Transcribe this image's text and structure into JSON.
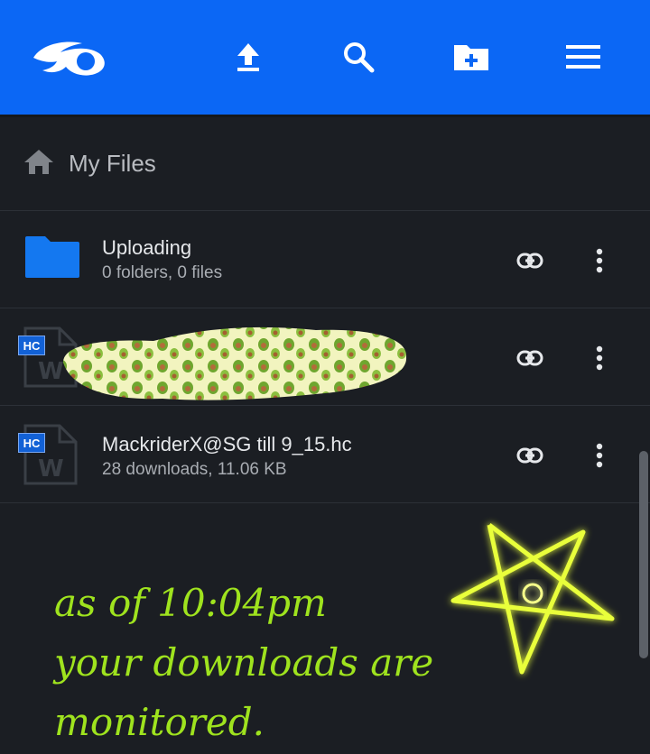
{
  "header": {
    "icons": [
      "logo-icon",
      "upload-icon",
      "search-icon",
      "new-folder-icon",
      "menu-icon"
    ],
    "color": "#0b67f5"
  },
  "breadcrumb": {
    "title": "My Files"
  },
  "files": [
    {
      "name": "Uploading",
      "meta": "0 folders, 0 files",
      "type": "folder"
    },
    {
      "name": "",
      "meta": "",
      "type": "hc",
      "badge": "HC",
      "redacted": true
    },
    {
      "name": "MackriderX@SG till 9_15.hc",
      "meta": "28 downloads, 11.06 KB",
      "type": "hc",
      "badge": "HC"
    }
  ],
  "overlay": {
    "lines": [
      "as of 10:04pm",
      "your downloads are",
      "monitored."
    ],
    "color": "#9fe31e"
  }
}
